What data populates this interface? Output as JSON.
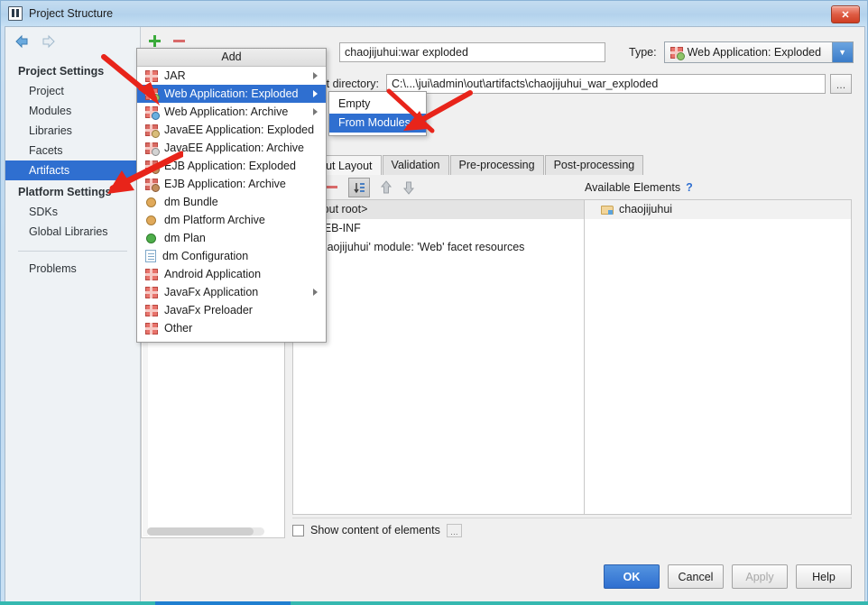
{
  "window": {
    "title": "Project Structure",
    "icon": "idea-logo-icon",
    "close_label": "✕"
  },
  "sidebar": {
    "groups": [
      {
        "title": "Project Settings",
        "items": [
          {
            "label": "Project",
            "selected": false
          },
          {
            "label": "Modules",
            "selected": false
          },
          {
            "label": "Libraries",
            "selected": false
          },
          {
            "label": "Facets",
            "selected": false
          },
          {
            "label": "Artifacts",
            "selected": true
          }
        ]
      },
      {
        "title": "Platform Settings",
        "items": [
          {
            "label": "SDKs",
            "selected": false
          },
          {
            "label": "Global Libraries",
            "selected": false
          }
        ]
      }
    ],
    "problems_label": "Problems"
  },
  "artifacts_toolbar": {
    "add_label": "+",
    "remove_label": "−"
  },
  "detail": {
    "name_value": "chaojijuhui:war exploded",
    "name_placeholder": "",
    "type_label": "Type:",
    "type_value": "Web Application: Exploded",
    "output_dir_label": "Output directory:",
    "output_dir_value": "C:\\...\\jui\\admin\\out\\artifacts\\chaojijuhui_war_exploded",
    "browse_label": "…"
  },
  "tabs": [
    {
      "label": "Output Layout",
      "active": true
    },
    {
      "label": "Validation",
      "active": false
    },
    {
      "label": "Pre-processing",
      "active": false
    },
    {
      "label": "Post-processing",
      "active": false
    }
  ],
  "editor_toolbar": {
    "add_label": "+",
    "remove_label": "−",
    "sort_label": "sort-icon",
    "up_label": "move-up-icon",
    "down_label": "move-down-icon",
    "available_elements_label": "Available Elements",
    "help_label": "?"
  },
  "output_tree": [
    {
      "label": "<output root>",
      "highlighted": true,
      "indent": 0
    },
    {
      "label": "WEB-INF",
      "highlighted": false,
      "indent": 1
    },
    {
      "label": "'chaojijuhui' module: 'Web' facet resources",
      "highlighted": false,
      "indent": 1
    }
  ],
  "available_elements": [
    {
      "label": "chaojijuhui",
      "icon": "module-folder-icon"
    }
  ],
  "bottom": {
    "show_content_label": "Show content of elements",
    "show_content_checked": false,
    "show_content_dots": "…"
  },
  "buttons": [
    {
      "label": "OK",
      "style": "primary",
      "enabled": true
    },
    {
      "label": "Cancel",
      "style": "normal",
      "enabled": true
    },
    {
      "label": "Apply",
      "style": "normal",
      "enabled": false
    },
    {
      "label": "Help",
      "style": "normal",
      "enabled": true
    }
  ],
  "add_menu": {
    "title": "Add",
    "items": [
      {
        "label": "JAR",
        "icon": "jar-icon",
        "submenu": true,
        "selected": false
      },
      {
        "label": "Web Application: Exploded",
        "icon": "web-exploded-icon",
        "submenu": true,
        "selected": true
      },
      {
        "label": "Web Application: Archive",
        "icon": "web-archive-icon",
        "submenu": true,
        "selected": false
      },
      {
        "label": "JavaEE Application: Exploded",
        "icon": "javaee-exploded-icon",
        "submenu": false,
        "selected": false
      },
      {
        "label": "JavaEE Application: Archive",
        "icon": "javaee-archive-icon",
        "submenu": false,
        "selected": false
      },
      {
        "label": "EJB Application: Exploded",
        "icon": "ejb-exploded-icon",
        "submenu": false,
        "selected": false
      },
      {
        "label": "EJB Application: Archive",
        "icon": "ejb-archive-icon",
        "submenu": false,
        "selected": false
      },
      {
        "label": "dm Bundle",
        "icon": "dm-bundle-icon",
        "submenu": false,
        "selected": false
      },
      {
        "label": "dm Platform Archive",
        "icon": "dm-platform-icon",
        "submenu": false,
        "selected": false
      },
      {
        "label": "dm Plan",
        "icon": "dm-plan-icon",
        "submenu": false,
        "selected": false
      },
      {
        "label": "dm Configuration",
        "icon": "dm-config-icon",
        "submenu": false,
        "selected": false
      },
      {
        "label": "Android Application",
        "icon": "android-icon",
        "submenu": false,
        "selected": false
      },
      {
        "label": "JavaFx Application",
        "icon": "javafx-icon",
        "submenu": true,
        "selected": false
      },
      {
        "label": "JavaFx Preloader",
        "icon": "javafx-preloader-icon",
        "submenu": false,
        "selected": false
      },
      {
        "label": "Other",
        "icon": "other-icon",
        "submenu": false,
        "selected": false
      }
    ]
  },
  "sub_menu": {
    "items": [
      {
        "label": "Empty",
        "selected": false
      },
      {
        "label": "From Modules...",
        "selected": true
      }
    ]
  },
  "colors": {
    "selection_blue": "#2f6fd0",
    "annotation_red": "#e8241a",
    "title_gradient_top": "#c4dcf0",
    "add_green": "#3bab3b",
    "remove_red": "#d96a6a"
  }
}
